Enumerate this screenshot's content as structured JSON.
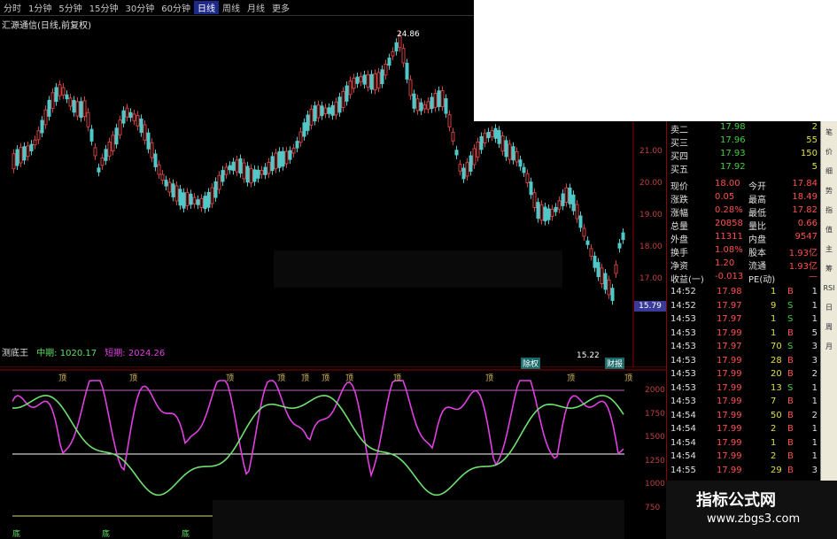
{
  "toolbar": {
    "periods": [
      "分时",
      "1分钟",
      "5分钟",
      "15分钟",
      "30分钟",
      "60分钟",
      "日线",
      "周线",
      "月线",
      "更多"
    ],
    "active_period": "日线"
  },
  "chart": {
    "title": "汇源通信(日线,前复权)",
    "high_label": "24.86",
    "low_label": "15.22",
    "current_price": "15.79",
    "price_axis": [
      "21.00",
      "20.00",
      "19.00",
      "18.00",
      "17.00"
    ],
    "event_tags": [
      "除权",
      "财报"
    ]
  },
  "indicator": {
    "name": "测底王",
    "mid_label": "中期:",
    "mid_value": "1020.17",
    "short_label": "短期:",
    "short_value": "2024.26",
    "axis": [
      "2000",
      "1750",
      "1500",
      "1250",
      "1000",
      "750"
    ],
    "top_marks": [
      "顶",
      "顶",
      "顶",
      "顶",
      "顶",
      "顶",
      "顶",
      "顶",
      "顶",
      "顶",
      "顶"
    ],
    "bottom_marks": [
      "底",
      "底",
      "底"
    ]
  },
  "quote": {
    "sell_rows": [
      {
        "label": "卖二",
        "price": "17.98",
        "vol": "2"
      },
      {
        "label": "买三",
        "price": "17.96",
        "vol": "55"
      },
      {
        "label": "买四",
        "price": "17.93",
        "vol": "150"
      },
      {
        "label": "买五",
        "price": "17.92",
        "vol": "5"
      }
    ],
    "stats": [
      {
        "l1": "现价",
        "v1": "18.00",
        "l2": "今开",
        "v2": "17.84"
      },
      {
        "l1": "涨跌",
        "v1": "0.05",
        "l2": "最高",
        "v2": "18.49"
      },
      {
        "l1": "涨幅",
        "v1": "0.28%",
        "l2": "最低",
        "v2": "17.82"
      },
      {
        "l1": "总量",
        "v1": "20858",
        "l2": "量比",
        "v2": "0.66"
      },
      {
        "l1": "外盘",
        "v1": "11311",
        "l2": "内盘",
        "v2": "9547"
      },
      {
        "l1": "换手",
        "v1": "1.08%",
        "l2": "股本",
        "v2": "1.93亿"
      },
      {
        "l1": "净资",
        "v1": "1.20",
        "l2": "流通",
        "v2": "1.93亿"
      },
      {
        "l1": "收益(一)",
        "v1": "-0.013",
        "l2": "PE(动)",
        "v2": "—"
      }
    ],
    "ticks": [
      {
        "t": "14:52",
        "p": "17.98",
        "v": "1",
        "s": "B",
        "n": "1"
      },
      {
        "t": "14:52",
        "p": "17.97",
        "v": "9",
        "s": "S",
        "n": "1"
      },
      {
        "t": "14:53",
        "p": "17.97",
        "v": "1",
        "s": "S",
        "n": "1"
      },
      {
        "t": "14:53",
        "p": "17.99",
        "v": "1",
        "s": "B",
        "n": "5"
      },
      {
        "t": "14:53",
        "p": "17.97",
        "v": "70",
        "s": "S",
        "n": "3"
      },
      {
        "t": "14:53",
        "p": "17.99",
        "v": "28",
        "s": "B",
        "n": "3"
      },
      {
        "t": "14:53",
        "p": "17.99",
        "v": "20",
        "s": "B",
        "n": "2"
      },
      {
        "t": "14:53",
        "p": "17.99",
        "v": "13",
        "s": "S",
        "n": "1"
      },
      {
        "t": "14:53",
        "p": "17.99",
        "v": "7",
        "s": "B",
        "n": "1"
      },
      {
        "t": "14:54",
        "p": "17.99",
        "v": "50",
        "s": "B",
        "n": "2"
      },
      {
        "t": "14:54",
        "p": "17.99",
        "v": "2",
        "s": "B",
        "n": "1"
      },
      {
        "t": "14:54",
        "p": "17.99",
        "v": "1",
        "s": "B",
        "n": "1"
      },
      {
        "t": "14:54",
        "p": "17.99",
        "v": "2",
        "s": "B",
        "n": "1"
      },
      {
        "t": "14:55",
        "p": "17.99",
        "v": "29",
        "s": "B",
        "n": "3"
      }
    ]
  },
  "sidebar": [
    "笔",
    "价",
    "细",
    "势",
    "指",
    "值",
    "主",
    "筹",
    "RSI",
    "日",
    "周",
    "月"
  ],
  "watermark": {
    "title": "指标公式网",
    "url": "www.zbgs3.com"
  },
  "colors": {
    "up": "#ff4040",
    "down": "#40c0c0",
    "short_line": "#e040e0",
    "mid_line": "#60e060"
  }
}
